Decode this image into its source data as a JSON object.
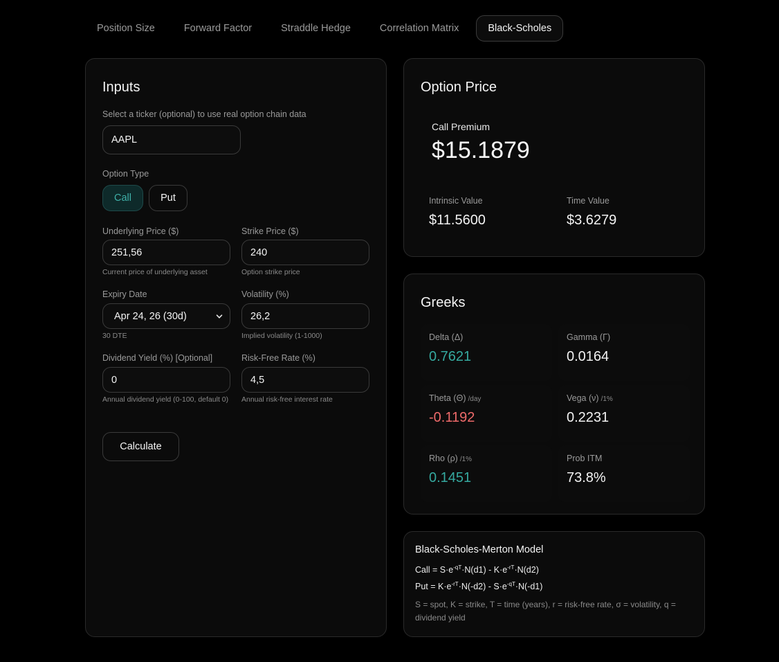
{
  "tabs": [
    {
      "label": "Position Size"
    },
    {
      "label": "Forward Factor"
    },
    {
      "label": "Straddle Hedge"
    },
    {
      "label": "Correlation Matrix"
    },
    {
      "label": "Black-Scholes"
    }
  ],
  "inputs": {
    "title": "Inputs",
    "ticker_hint": "Select a ticker (optional) to use real option chain data",
    "ticker_value": "AAPL",
    "option_type_label": "Option Type",
    "call_label": "Call",
    "put_label": "Put",
    "selected_type": "Call",
    "underlying": {
      "label": "Underlying Price ($)",
      "value": "251,56",
      "hint": "Current price of underlying asset"
    },
    "strike": {
      "label": "Strike Price ($)",
      "value": "240",
      "hint": "Option strike price"
    },
    "expiry": {
      "label": "Expiry Date",
      "value": "Apr 24, 26 (30d)",
      "hint": "30 DTE"
    },
    "volatility": {
      "label": "Volatility (%)",
      "value": "26,2",
      "hint": "Implied volatility (1-1000)"
    },
    "dividend": {
      "label": "Dividend Yield (%) [Optional]",
      "value": "0",
      "hint": "Annual dividend yield (0-100, default 0)"
    },
    "riskfree": {
      "label": "Risk-Free Rate (%)",
      "value": "4,5",
      "hint": "Annual risk-free interest rate"
    },
    "calculate_label": "Calculate"
  },
  "price": {
    "title": "Option Price",
    "premium_label": "Call Premium",
    "premium_value": "$15.1879",
    "intrinsic_label": "Intrinsic Value",
    "intrinsic_value": "$11.5600",
    "time_label": "Time Value",
    "time_value": "$3.6279"
  },
  "greeks": {
    "title": "Greeks",
    "delta": {
      "label": "Delta (Δ)",
      "value": "0.7621"
    },
    "gamma": {
      "label": "Gamma (Γ)",
      "value": "0.0164"
    },
    "theta": {
      "label": "Theta (Θ)",
      "unit": "/day",
      "value": "-0.1192"
    },
    "vega": {
      "label": "Vega (ν)",
      "unit": "/1%",
      "value": "0.2231"
    },
    "rho": {
      "label": "Rho (ρ)",
      "unit": "/1%",
      "value": "0.1451"
    },
    "prob_itm": {
      "label": "Prob ITM",
      "value": "73.8%"
    }
  },
  "model": {
    "title": "Black-Scholes-Merton Model",
    "call_a": "Call = S·e",
    "call_sup1": "-qT",
    "call_b": "·N(d1) - K·e",
    "call_sup2": "-rT",
    "call_c": "·N(d2)",
    "put_a": "Put = K·e",
    "put_sup1": "-rT",
    "put_b": "·N(-d2) - S·e",
    "put_sup2": "-qT",
    "put_c": "·N(-d1)",
    "legend": "S = spot, K = strike, T = time (years), r = risk-free rate, σ = volatility, q = dividend yield"
  },
  "colors": {
    "accent": "#35a99f",
    "negative": "#ee6a6a",
    "background": "#000000"
  }
}
